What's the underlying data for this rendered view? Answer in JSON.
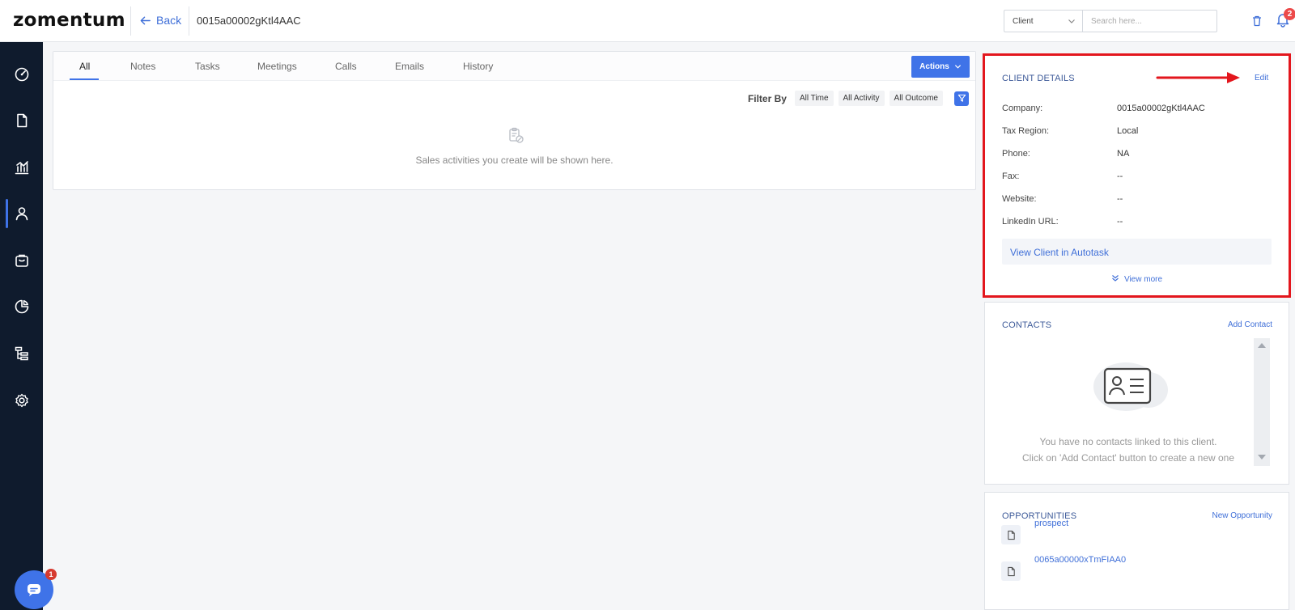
{
  "header": {
    "logo": "zomentum",
    "back_label": "Back",
    "record_id": "0015a00002gKtl4AAC",
    "search_scope": "Client",
    "search_placeholder": "Search here...",
    "notification_count": "2"
  },
  "sidebar": {
    "items": [
      {
        "icon": "dashboard-icon"
      },
      {
        "icon": "document-icon"
      },
      {
        "icon": "analytics-icon"
      },
      {
        "icon": "user-icon",
        "active": true
      },
      {
        "icon": "briefcase-icon"
      },
      {
        "icon": "pie-chart-icon"
      },
      {
        "icon": "hierarchy-icon"
      },
      {
        "icon": "settings-icon"
      }
    ],
    "chat_badge": "1"
  },
  "activity": {
    "tabs": [
      "All",
      "Notes",
      "Tasks",
      "Meetings",
      "Calls",
      "Emails",
      "History"
    ],
    "active_tab": "All",
    "actions_label": "Actions",
    "filter_label": "Filter By",
    "filters": [
      "All Time",
      "All Activity",
      "All Outcome"
    ],
    "empty_message": "Sales activities you create will be shown here."
  },
  "client_details": {
    "title": "CLIENT DETAILS",
    "edit_label": "Edit",
    "fields": [
      {
        "label": "Company:",
        "value": "0015a00002gKtl4AAC"
      },
      {
        "label": "Tax Region:",
        "value": "Local"
      },
      {
        "label": "Phone:",
        "value": "NA"
      },
      {
        "label": "Fax:",
        "value": "--"
      },
      {
        "label": "Website:",
        "value": "--"
      },
      {
        "label": "LinkedIn URL:",
        "value": "--"
      }
    ],
    "view_autotask_label": "View Client in Autotask",
    "view_more_label": "View more"
  },
  "contacts": {
    "title": "CONTACTS",
    "add_label": "Add Contact",
    "empty_line1": "You have no contacts linked to this client.",
    "empty_line2": "Click on 'Add Contact' button to create a new one"
  },
  "opportunities": {
    "title": "OPPORTUNITIES",
    "new_label": "New Opportunity",
    "items": [
      "prospect",
      "0065a00000xTmFIAA0"
    ]
  },
  "colors": {
    "accent": "#3f73e8",
    "sidebar": "#0f1b2d",
    "highlight": "#e3161d"
  }
}
